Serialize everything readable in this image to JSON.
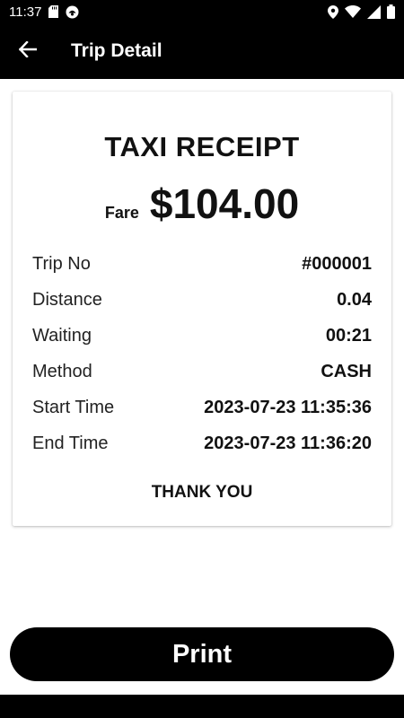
{
  "status_bar": {
    "time": "11:37",
    "icons": [
      "sd-card-icon",
      "notification-app-icon",
      "location-icon",
      "wifi-icon",
      "signal-icon",
      "battery-icon"
    ]
  },
  "app_bar": {
    "back_icon": "arrow-left-icon",
    "title": "Trip Detail"
  },
  "receipt": {
    "title": "TAXI RECEIPT",
    "fare_label": "Fare",
    "fare_value": "$104.00",
    "rows": [
      {
        "label": "Trip No",
        "value": "#000001"
      },
      {
        "label": "Distance",
        "value": "0.04"
      },
      {
        "label": "Waiting",
        "value": "00:21"
      },
      {
        "label": "Method",
        "value": "CASH"
      },
      {
        "label": "Start Time",
        "value": "2023-07-23 11:35:36"
      },
      {
        "label": "End Time",
        "value": "2023-07-23 11:36:20"
      }
    ],
    "footer": "THANK YOU"
  },
  "actions": {
    "print_label": "Print"
  },
  "colors": {
    "bar_background": "#000000",
    "card_background": "#ffffff",
    "button_background": "#000000",
    "button_text": "#ffffff"
  }
}
